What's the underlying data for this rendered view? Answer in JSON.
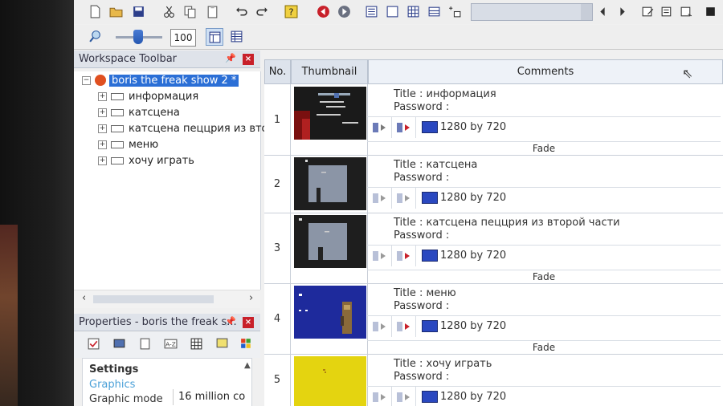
{
  "toolbar": {
    "zoom_value": "100",
    "icons": [
      "new-icon",
      "open-icon",
      "save-icon",
      "cut-icon",
      "copy-icon",
      "paste-icon",
      "undo-icon",
      "redo-icon",
      "help-icon",
      "back-icon",
      "forward-icon"
    ]
  },
  "workspace": {
    "title": "Workspace Toolbar",
    "root": "boris the freak show 2 *",
    "items": [
      {
        "label": "информация"
      },
      {
        "label": "катсцена"
      },
      {
        "label": "катсцена пеццрия из втор"
      },
      {
        "label": "меню"
      },
      {
        "label": "хочу играть"
      }
    ]
  },
  "properties": {
    "title": "Properties - boris the freak s...",
    "settings": "Settings",
    "graphics": "Graphics",
    "graphic_mode_label": "Graphic mode",
    "graphic_mode_value": "16 million co"
  },
  "grid": {
    "headers": {
      "no": "No.",
      "thumbnail": "Thumbnail",
      "comments": "Comments"
    },
    "rows": [
      {
        "no": "1",
        "title": "Title : информация",
        "password": "Password :",
        "resolution": "1280 by 720",
        "transition": "Fade"
      },
      {
        "no": "2",
        "title": "Title : катсцена",
        "password": "Password :",
        "resolution": "1280 by 720",
        "transition": ""
      },
      {
        "no": "3",
        "title": "Title : катсцена пеццрия из второй части",
        "password": "Password :",
        "resolution": "1280 by 720",
        "transition": "Fade"
      },
      {
        "no": "4",
        "title": "Title : меню",
        "password": "Password :",
        "resolution": "1280 by 720",
        "transition": "Fade"
      },
      {
        "no": "5",
        "title": "Title : хочу играть",
        "password": "Password :",
        "resolution": "1280 by 720",
        "transition": ""
      }
    ]
  },
  "colors": {
    "selection": "#2b6fd6",
    "close": "#c8202a",
    "transition_arrow": "#c8202a"
  }
}
